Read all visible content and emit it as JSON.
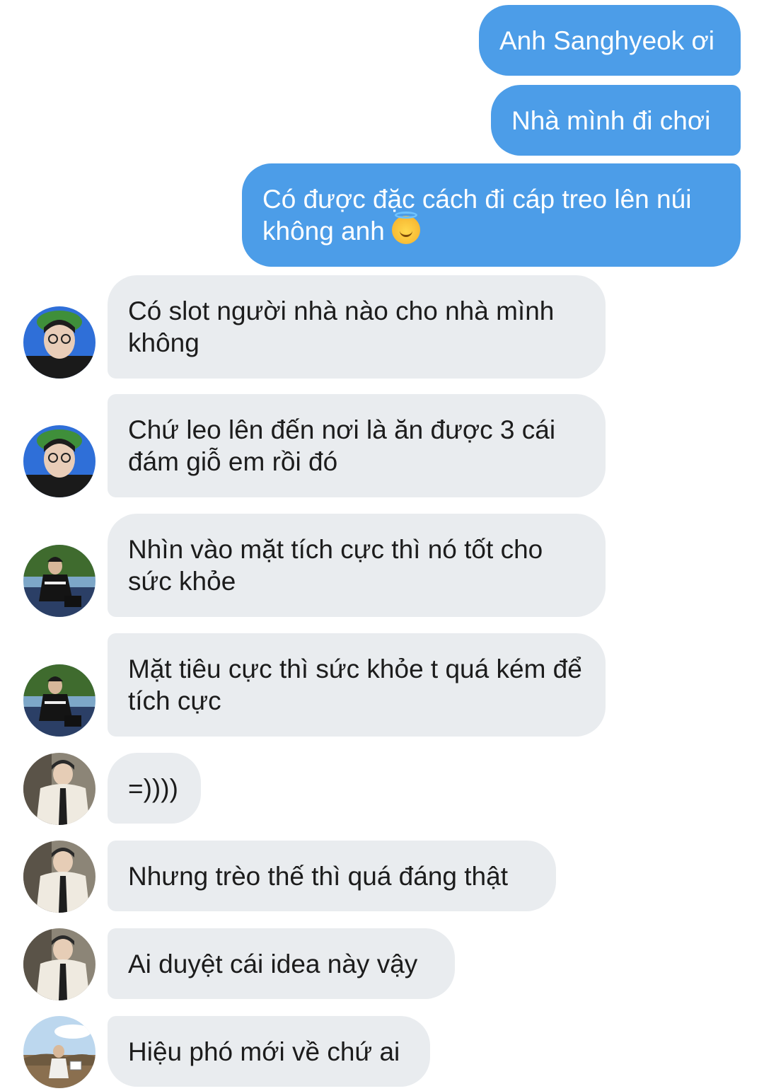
{
  "conversation": {
    "sent_messages": [
      {
        "text": "Anh Sanghyeok ơi"
      },
      {
        "text": "Nhà mình đi chơi"
      },
      {
        "text": "Có được đặc cách đi cáp treo lên núi không anh",
        "emoji": "innocent-smiley-icon"
      }
    ],
    "received_messages": [
      {
        "text": "Có slot người nhà nào cho nhà mình không",
        "avatar": "avatar-blue-bg"
      },
      {
        "text": "Chứ leo lên đến nơi là ăn được 3 cái đám giỗ em rồi đó",
        "avatar": "avatar-blue-bg"
      },
      {
        "text": "Nhìn vào mặt tích cực thì nó tốt cho sức khỏe",
        "avatar": "avatar-outdoor"
      },
      {
        "text": "Mặt tiêu cực thì sức khỏe t quá kém để tích cực",
        "avatar": "avatar-outdoor"
      },
      {
        "text": "=))))",
        "avatar": "avatar-white-jacket"
      },
      {
        "text": "Nhưng trèo thế thì quá đáng thật",
        "avatar": "avatar-white-jacket"
      },
      {
        "text": "Ai duyệt cái idea này vậy",
        "avatar": "avatar-white-jacket"
      },
      {
        "text": "Hiệu phó mới về chứ ai",
        "avatar": "avatar-sky"
      }
    ]
  },
  "colors": {
    "sent_bubble": "#4c9de8",
    "received_bubble": "#e9ecef",
    "sent_text": "#ffffff",
    "received_text": "#1c1c1c"
  }
}
